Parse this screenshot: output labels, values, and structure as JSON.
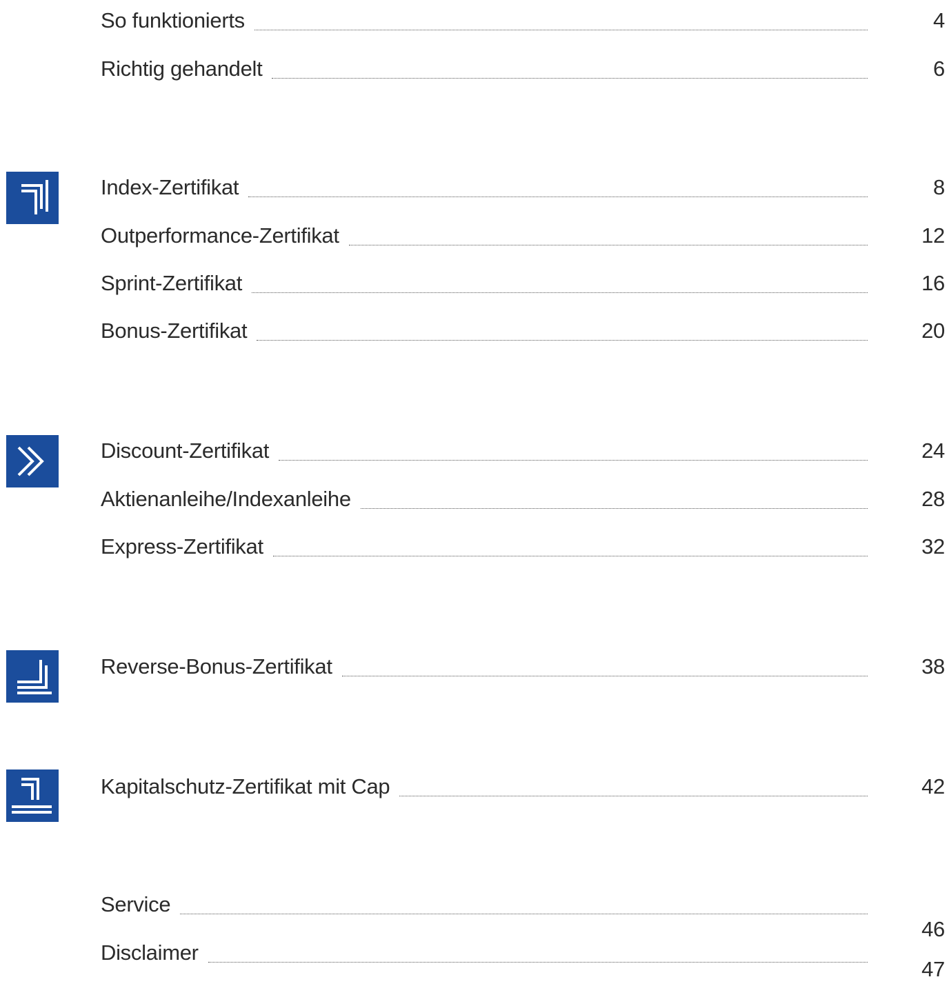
{
  "intro": [
    {
      "label": "So funktionierts",
      "page": "4"
    },
    {
      "label": "Richtig gehandelt",
      "page": "6"
    }
  ],
  "group_1": [
    {
      "label": "Index-Zertifikat",
      "page": "8"
    },
    {
      "label": "Outperformance-Zertifikat",
      "page": "12"
    },
    {
      "label": "Sprint-Zertifikat",
      "page": "16"
    },
    {
      "label": "Bonus-Zertifikat",
      "page": "20"
    }
  ],
  "group_2": [
    {
      "label": "Discount-Zertifikat",
      "page": "24"
    },
    {
      "label": "Aktienanleihe/Indexanleihe",
      "page": "28"
    },
    {
      "label": "Express-Zertifikat",
      "page": "32"
    }
  ],
  "group_3": [
    {
      "label": "Reverse-Bonus-Zertifikat",
      "page": "38"
    }
  ],
  "group_4": [
    {
      "label": "Kapitalschutz-Zertifikat mit Cap",
      "page": "42"
    }
  ],
  "closing": [
    {
      "label": "Service",
      "page": "46"
    },
    {
      "label": "Disclaimer",
      "page": "47"
    }
  ],
  "icons": {
    "brand_color": "#1b4d9c",
    "group_1": "rising-corner-arrows-icon",
    "group_2": "double-chevron-right-icon",
    "group_3": "falling-corner-arrows-icon",
    "group_4": "protected-corner-arrows-icon"
  }
}
